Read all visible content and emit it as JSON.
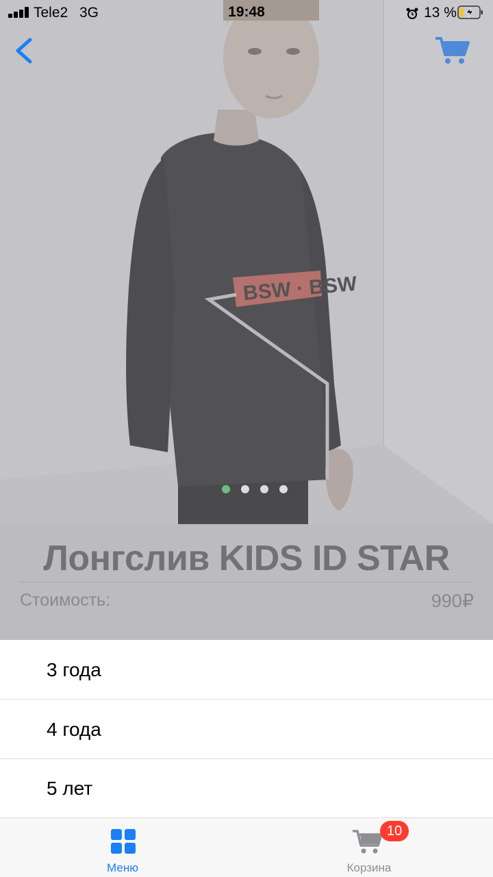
{
  "status_bar": {
    "carrier": "Tele2",
    "network": "3G",
    "time": "19:48",
    "battery_percent": "13 %"
  },
  "nav": {
    "back_icon": "chevron-left-icon",
    "cart_icon": "cart-icon"
  },
  "hero": {
    "image_slides": 4,
    "active_slide": 1,
    "print_text": "BSW · BSW"
  },
  "product": {
    "title": "Лонгслив KIDS ID STAR",
    "price_label": "Стоимость:",
    "price_value": "990₽"
  },
  "sizes": {
    "options": [
      "3 года",
      "4 года",
      "5 лет"
    ]
  },
  "tab_bar": {
    "tabs": [
      {
        "label": "Меню",
        "icon": "grid-icon",
        "active": true
      },
      {
        "label": "Корзина",
        "icon": "cart-icon",
        "badge": "10"
      }
    ]
  },
  "colors": {
    "accent": "#1b7ff5",
    "badge": "#ff3b30",
    "dot_active": "#6dbb86"
  }
}
